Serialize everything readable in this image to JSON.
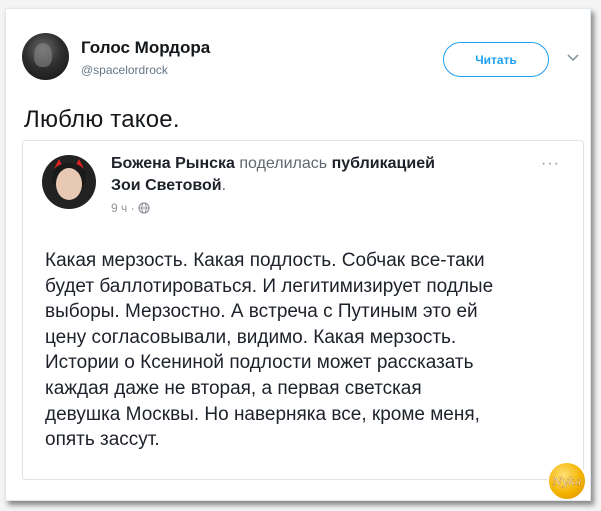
{
  "tweet": {
    "author_name": "Голос Мордора",
    "author_handle": "@spacelordrock",
    "follow_label": "Читать",
    "text": "Люблю такое."
  },
  "embed": {
    "author": "Божена Рынска",
    "action": " поделилась ",
    "object": "публикацией",
    "object_owner": "Зои Световой",
    "object_owner_suffix": ".",
    "time": "9 ч ·",
    "more": "···",
    "body": "Какая мерзость. Какая подлость. Собчак все-таки\nбудет баллотироваться. И легитимизирует подлые\nвыборы. Мерзостно. А встреча с Путиным это ей\nцену согласовывали, видимо. Какая мерзость.\nИстории о Ксениной подлости может рассказать\nкаждая даже не вторая, а первая светская\nдевушка Москвы. Но наверняка все, кроме меня,\nопять зассут."
  },
  "watermark": {
    "text": "Nyka"
  },
  "colors": {
    "follow_blue": "#1da1f2",
    "watermark_gold": "#f4b400"
  },
  "icons": [
    "chevron-down-icon",
    "globe-icon"
  ]
}
